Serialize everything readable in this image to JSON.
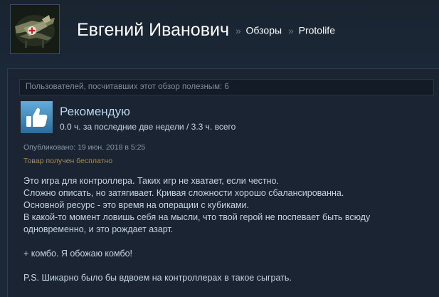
{
  "header": {
    "user_name": "Евгений Иванович",
    "separator": "»",
    "crumbs": [
      "Обзоры",
      "Protolife"
    ]
  },
  "review": {
    "helpful_text": "Пользователей, посчитавших этот обзор полезным: 6",
    "verdict": "Рекомендую",
    "hours": "0.0 ч. за последние две недели / 3.3 ч. всего",
    "posted": "Опубликовано: 19 июн. 2018 в 5:25",
    "free_product": "Товар получен бесплатно",
    "lines": [
      "Это игра для контроллера. Таких игр не хватает, если честно.",
      "Сложно описать, но затягивает. Кривая сложности хорошо сбалансированна.",
      "Основной ресурс - это время на операции с кубиками.",
      "В какой-то момент ловишь себя на мысли, что твой герой не поспевает быть всюду",
      "одновременно, и это рождает азарт.",
      "",
      "+ комбо. Я обожаю комбо!",
      "",
      "P.S. Шикарно было бы вдвоем на контроллерах в такое сыграть."
    ]
  },
  "colors": {
    "background": "#1b2838",
    "thumb_blue": "#4f9bd1",
    "verdict_text": "#b9d6ee",
    "free_product_text": "#a98c4e"
  },
  "icons": {
    "avatar": "aircraft-avatar",
    "thumb": "thumbs-up-icon"
  }
}
